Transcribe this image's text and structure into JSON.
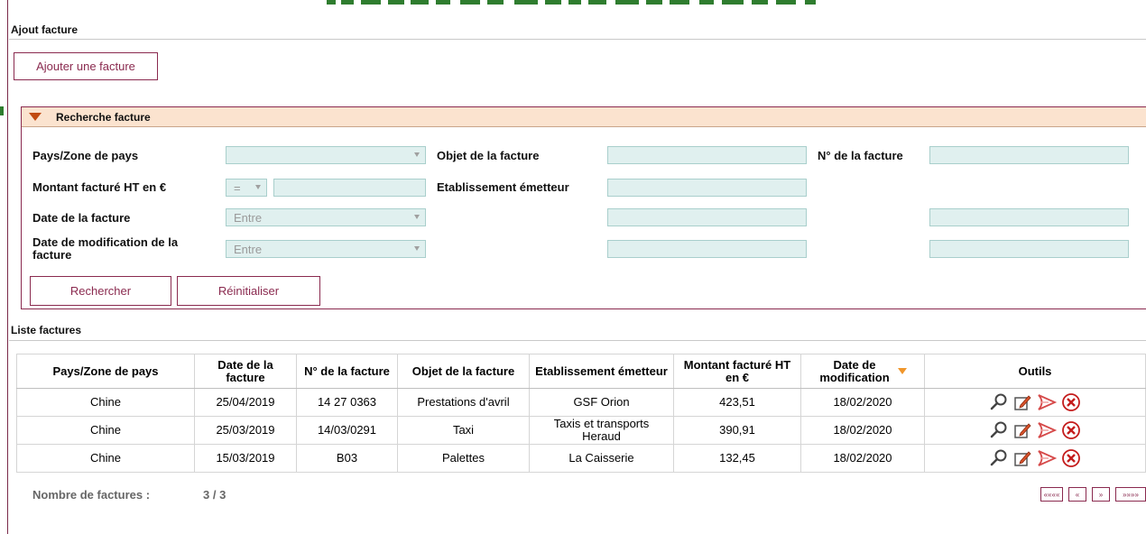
{
  "colors": {
    "accent": "#8a2a4f",
    "panel_header": "#fbe3cf",
    "field": "#e0f0ef",
    "sort_arrow": "#f0962b",
    "top_banner": "#2f7d2f"
  },
  "ajout": {
    "title": "Ajout facture",
    "add_button": "Ajouter une facture"
  },
  "search": {
    "header": "Recherche facture",
    "labels": {
      "pays": "Pays/Zone de pays",
      "objet": "Objet de la facture",
      "numero": "N° de la facture",
      "montant": "Montant facturé HT en €",
      "etablissement": "Etablissement émetteur",
      "date_facture": "Date de la facture",
      "date_modif": "Date de modification de la facture"
    },
    "operator_value": "=",
    "date_facture_mode": "Entre",
    "date_modif_mode": "Entre",
    "search_button": "Rechercher",
    "reset_button": "Réinitialiser"
  },
  "list": {
    "title": "Liste factures",
    "columns": [
      "Pays/Zone de pays",
      "Date de la facture",
      "N° de la facture",
      "Objet de la facture",
      "Etablissement émetteur",
      "Montant facturé HT en €",
      "Date de modification",
      "Outils"
    ],
    "rows": [
      {
        "pays": "Chine",
        "date": "25/04/2019",
        "numero": "14 27 0363",
        "objet": "Prestations d'avril",
        "etablissement": "GSF Orion",
        "montant": "423,51",
        "modif": "18/02/2020"
      },
      {
        "pays": "Chine",
        "date": "25/03/2019",
        "numero": "14/03/0291",
        "objet": "Taxi",
        "etablissement": "Taxis et transports Heraud",
        "montant": "390,91",
        "modif": "18/02/2020"
      },
      {
        "pays": "Chine",
        "date": "15/03/2019",
        "numero": "B03",
        "objet": "Palettes",
        "etablissement": "La Caisserie",
        "montant": "132,45",
        "modif": "18/02/2020"
      }
    ],
    "tool_icons": [
      "magnifier-icon",
      "edit-icon",
      "pdf-icon",
      "delete-icon"
    ],
    "count_label": "Nombre de factures :",
    "count_value": "3 / 3",
    "pager": {
      "first": "««««",
      "prev": "«",
      "next": "»",
      "last": "»»»»"
    }
  }
}
